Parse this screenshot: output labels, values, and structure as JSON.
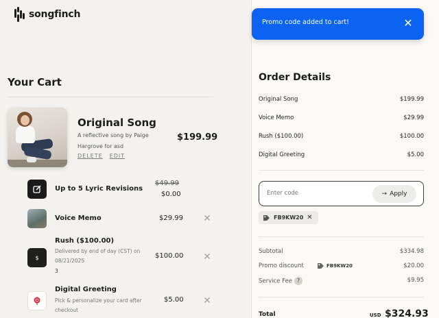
{
  "brand": {
    "name": "songfinch"
  },
  "cart": {
    "title": "Your Cart",
    "product": {
      "name": "Original Song",
      "description": "A reflective song by Paige Hargrove for asd",
      "price": "$199.99",
      "delete_label": "DELETE",
      "edit_label": "EDIT"
    },
    "addons": [
      {
        "name": "Up to 5 Lyric Revisions",
        "old_price": "$49.99",
        "price": "$0.00",
        "icon": "edit-icon"
      },
      {
        "name": "Voice Memo",
        "price": "$29.99",
        "icon": "voice-memo-thumbnail"
      },
      {
        "name": "Rush ($100.00)",
        "sub": "Delivered by end of day (CST) on 08/21/2025",
        "qty": "3",
        "price": "$100.00",
        "icon": "dollar-icon"
      },
      {
        "name": "Digital Greeting",
        "sub": "Pick & personalize your card after checkout",
        "price": "$5.00",
        "icon": "rose-icon"
      }
    ]
  },
  "toast": {
    "message": "Promo code added to cart!"
  },
  "order": {
    "title": "Order Details",
    "lines": [
      {
        "label": "Original Song",
        "value": "$199.99"
      },
      {
        "label": "Voice Memo",
        "value": "$29.99"
      },
      {
        "label": "Rush ($100.00)",
        "value": "$100.00"
      },
      {
        "label": "Digital Greeting",
        "value": "$5.00"
      }
    ],
    "promo": {
      "placeholder": "Enter code",
      "apply_label": "Apply",
      "applied_code": "FB9KW20"
    },
    "summary": {
      "subtotal_label": "Subtotal",
      "subtotal": "$334.98",
      "discount_label": "Promo discount",
      "discount_code": "FB9KW20",
      "discount": "$20.00",
      "fee_label": "Service Fee",
      "fee_help": "?",
      "fee": "$9.95"
    },
    "total": {
      "label": "Total",
      "currency": "USD",
      "value": "$324.93"
    }
  },
  "colors": {
    "accent": "#0a63f2",
    "background": "#f3f2ee",
    "panel": "#faf9f6"
  }
}
